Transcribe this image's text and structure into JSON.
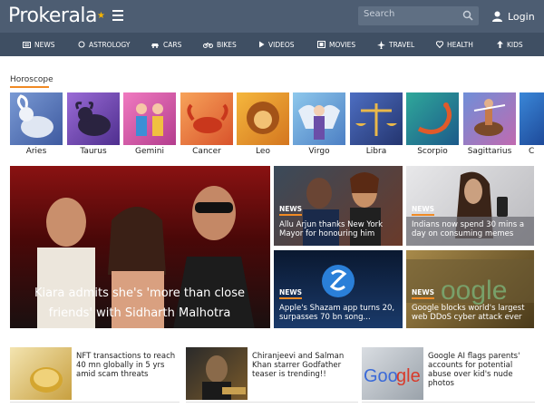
{
  "header": {
    "logo": "Prokerala",
    "search_placeholder": "Search",
    "login_label": "Login"
  },
  "nav": [
    {
      "label": "NEWS",
      "icon": "newspaper-icon"
    },
    {
      "label": "ASTROLOGY",
      "icon": "sun-icon"
    },
    {
      "label": "CARS",
      "icon": "car-icon"
    },
    {
      "label": "BIKES",
      "icon": "bike-icon"
    },
    {
      "label": "VIDEOS",
      "icon": "play-icon"
    },
    {
      "label": "MOVIES",
      "icon": "film-icon"
    },
    {
      "label": "TRAVEL",
      "icon": "plane-icon"
    },
    {
      "label": "HEALTH",
      "icon": "health-icon"
    },
    {
      "label": "KIDS",
      "icon": "kids-icon"
    }
  ],
  "horoscope": {
    "title": "Horoscope",
    "signs": [
      "Aries",
      "Taurus",
      "Gemini",
      "Cancer",
      "Leo",
      "Virgo",
      "Libra",
      "Scorpio",
      "Sagittarius",
      "C"
    ]
  },
  "featured": {
    "caption": "Kiara admits she's 'more than close friends' with Sidharth Malhotra"
  },
  "news_cards": [
    {
      "badge": "NEWS",
      "caption": "Allu Arjun thanks New York Mayor for honouring him"
    },
    {
      "badge": "NEWS",
      "caption": "Indians now spend 30 mins a day on consuming memes"
    },
    {
      "badge": "NEWS",
      "caption": "Apple's Shazam app turns 20, surpasses 70 bn song..."
    },
    {
      "badge": "NEWS",
      "caption": "Google blocks world's largest web DDoS cyber attack ever"
    }
  ],
  "small_news": [
    {
      "text": "NFT transactions to reach 40 mn globally in 5 yrs amid scam threats"
    },
    {
      "text": "Chiranjeevi and Salman Khan starrer Godfather teaser is trending!!"
    },
    {
      "text": "Google AI flags parents' accounts for potential abuse over kid's nude photos"
    }
  ],
  "colors": {
    "topbar": "#4d5d72",
    "navbar": "#3f4f63",
    "accent": "#f08a24"
  }
}
